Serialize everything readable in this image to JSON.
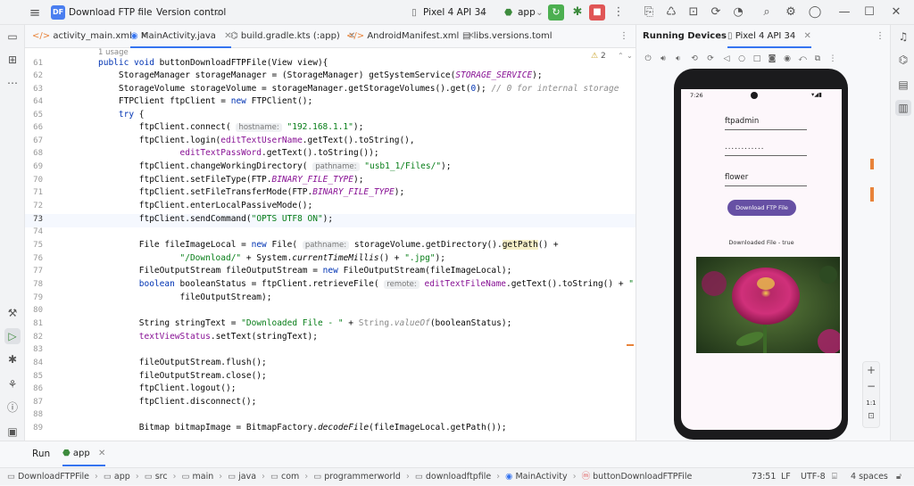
{
  "titlebar": {
    "project_badge": "DF",
    "project_name": "Download FTP file",
    "version_control": "Version control",
    "device": "Pixel 4 API 34",
    "run_config": "app"
  },
  "tabs": [
    {
      "label": "activity_main.xml"
    },
    {
      "label": "MainActivity.java"
    },
    {
      "label": "build.gradle.kts (:app)"
    },
    {
      "label": "AndroidManifest.xml"
    },
    {
      "label": "libs.versions.toml"
    }
  ],
  "editor": {
    "usage_label": "1 usage",
    "warning_count": "2",
    "hints": {
      "hostname": "hostname:",
      "pathname": "pathname:",
      "remote": "remote:"
    },
    "lines": [
      {
        "n": "61"
      },
      {
        "n": "62"
      },
      {
        "n": "63"
      },
      {
        "n": "64"
      },
      {
        "n": "65"
      },
      {
        "n": "66"
      },
      {
        "n": "67"
      },
      {
        "n": "68"
      },
      {
        "n": "69"
      },
      {
        "n": "70"
      },
      {
        "n": "71"
      },
      {
        "n": "72"
      },
      {
        "n": "73"
      },
      {
        "n": "74"
      },
      {
        "n": "75"
      },
      {
        "n": "76"
      },
      {
        "n": "77"
      },
      {
        "n": "78"
      },
      {
        "n": "79"
      },
      {
        "n": "80"
      },
      {
        "n": "81"
      },
      {
        "n": "82"
      },
      {
        "n": "83"
      },
      {
        "n": "84"
      },
      {
        "n": "85"
      },
      {
        "n": "86"
      },
      {
        "n": "87"
      },
      {
        "n": "88"
      },
      {
        "n": "89"
      }
    ]
  },
  "running_devices": {
    "panel_title": "Running Devices",
    "device_tab": "Pixel 4 API 34",
    "phone": {
      "time": "7:26",
      "username_value": "ftpadmin",
      "password_value": "............",
      "filename_value": "flower",
      "download_button": "Download FTP File",
      "status_text": "Downloaded File - true"
    },
    "zoom_ratio": "1:1"
  },
  "runbar": {
    "run_tab": "Run",
    "app_tab": "app"
  },
  "breadcrumb": [
    "DownloadFTPFile",
    "app",
    "src",
    "main",
    "java",
    "com",
    "programmerworld",
    "downloadftpfile",
    "MainActivity",
    "buttonDownloadFTPFile"
  ],
  "statusbar": {
    "position": "73:51",
    "line_ending": "LF",
    "encoding": "UTF-8",
    "indent": "4 spaces"
  },
  "colors": {
    "accent": "#3574f0",
    "phone_button": "#6650a4",
    "run_green": "#4caf50",
    "stop_red": "#e05555"
  }
}
